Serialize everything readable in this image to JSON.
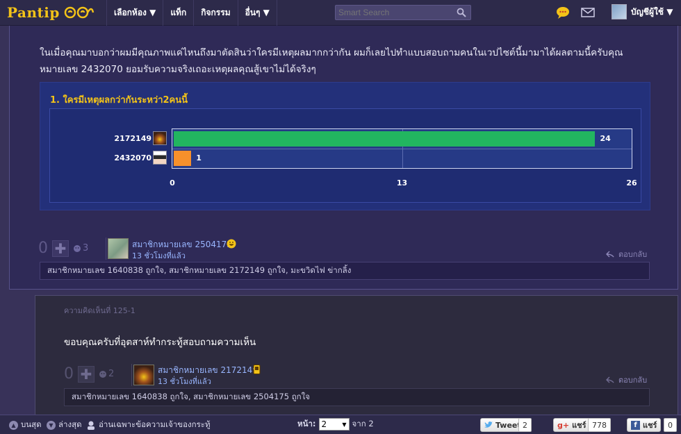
{
  "brand": {
    "logo_text": "Pantip"
  },
  "nav": {
    "items": [
      {
        "label": "เลือกห้อง ▼"
      },
      {
        "label": "แท็ก"
      },
      {
        "label": "กิจกรรม"
      },
      {
        "label": "อื่นๆ ▼"
      }
    ]
  },
  "search": {
    "placeholder": "Smart Search"
  },
  "user_menu": {
    "label": "บัญชีผู้ใช้ ▼"
  },
  "comment1": {
    "text": "ในเมื่อคุณมาบอกว่าผมมีคุณภาพแค่ไหนถึงมาตัดสินว่าใครมีเหตุผลมากกว่ากัน ผมก็เลยไปทำแบบสอบถามคนในเวปไซต์นี้มามาได้ผลตามนี้ครับคุณหมายเลข 2432070 ยอมรับความจริงเถอะเหตุผลคุณสู้เขาไม่ได้จริงๆ",
    "poll_title": "1. ใครมีเหตุผลกว่ากันระหว่า2คนนี้",
    "vote_count": "0",
    "emotion_count": "3",
    "member_name": "สมาชิกหมายเลข 2504175",
    "time": "13 ชั่วโมงที่แล้ว",
    "reply_label": "ตอบกลับ",
    "likes": "สมาชิกหมายเลข 1640838 ถูกใจ, สมาชิกหมายเลข 2172149 ถูกใจ, มะขวิดไฟ ข่ากลิ้ง"
  },
  "chart_data": {
    "type": "bar",
    "orientation": "horizontal",
    "title": "1. ใครมีเหตุผลกว่ากันระหว่า2คนนี้",
    "categories": [
      "2172149",
      "2432070"
    ],
    "values": [
      24,
      1
    ],
    "colors": [
      "#22b560",
      "#f7902b"
    ],
    "xlim": [
      0,
      26
    ],
    "xticks": [
      "0",
      "13",
      "26"
    ],
    "grid": true
  },
  "comment2": {
    "label": "ความคิดเห็นที่ 125-1",
    "text": "ขอบคุณครับที่อุตสาห์ทำกระทู้สอบถามความเห็น",
    "vote_count": "0",
    "emotion_count": "2",
    "member_name": "สมาชิกหมายเลข 2172149",
    "time": "13 ชั่วโมงที่แล้ว",
    "reply_label": "ตอบกลับ",
    "likes": "สมาชิกหมายเลข 1640838 ถูกใจ, สมาชิกหมายเลข 2504175 ถูกใจ"
  },
  "footer": {
    "top_label": "บนสุด",
    "bottom_label": "ล่างสุด",
    "owner_only_label": "อ่านเฉพาะข้อความเจ้าของกระทู้",
    "page_label": "หน้า:",
    "page_value": "2",
    "page_total": "จาก 2",
    "tweet_label": "Tweet",
    "tweet_count": "2",
    "gplus_label": "แชร์",
    "gplus_count": "778",
    "fb_label": "แชร์",
    "fb_count": "0"
  },
  "colors": {
    "accent": "#f3c318",
    "link": "#99b6ff",
    "background": "#383259"
  }
}
